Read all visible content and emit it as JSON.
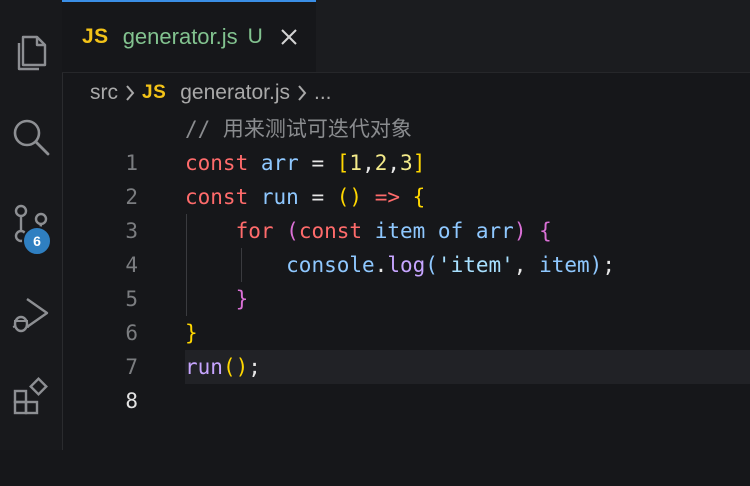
{
  "activity_bar": {
    "items": [
      {
        "name": "explorer",
        "icon": "files-icon"
      },
      {
        "name": "search",
        "icon": "search-icon"
      },
      {
        "name": "source-control",
        "icon": "source-control-icon",
        "badge": "6"
      },
      {
        "name": "run-and-debug",
        "icon": "run-debug-icon"
      },
      {
        "name": "extensions",
        "icon": "extensions-icon"
      }
    ],
    "badge_color": "#2f7fc1"
  },
  "tab": {
    "icon_text": "JS",
    "file_name": "generator.js",
    "status": "U",
    "accent": "#3a8ee6"
  },
  "breadcrumb": {
    "folder": "src",
    "icon_text": "JS",
    "file": "generator.js",
    "more": "..."
  },
  "editor": {
    "current_line": 8,
    "lines": [
      {
        "n": "1"
      },
      {
        "n": "2"
      },
      {
        "n": "3"
      },
      {
        "n": "4"
      },
      {
        "n": "5"
      },
      {
        "n": "6"
      },
      {
        "n": "7"
      },
      {
        "n": "8"
      }
    ],
    "code": {
      "l1_comment": "// 用来测试可迭代对象",
      "l2_const": "const",
      "l2_var": "arr",
      "l2_eq": " = ",
      "l2_ob": "[",
      "l2_n1": "1",
      "l2_c1": ",",
      "l2_n2": "2",
      "l2_c2": ",",
      "l2_n3": "3",
      "l2_cb": "]",
      "l3_const": "const",
      "l3_var": "run",
      "l3_eq": " = ",
      "l3_paren": "()",
      "l3_arrow": " => ",
      "l3_brace": "{",
      "l4_for": "for",
      "l4_op": " (",
      "l4_const": "const",
      "l4_item": "item",
      "l4_of": "of",
      "l4_arr": "arr",
      "l4_cp": ")",
      "l4_brace": "{",
      "l5_console": "console",
      "l5_dot": ".",
      "l5_log": "log",
      "l5_op": "(",
      "l5_str": "'item'",
      "l5_comma": ", ",
      "l5_item": "item",
      "l5_cp": ")",
      "l5_semi": ";",
      "l6_brace": "}",
      "l7_brace": "}",
      "l8_run": "run",
      "l8_paren": "()",
      "l8_semi": ";"
    }
  }
}
